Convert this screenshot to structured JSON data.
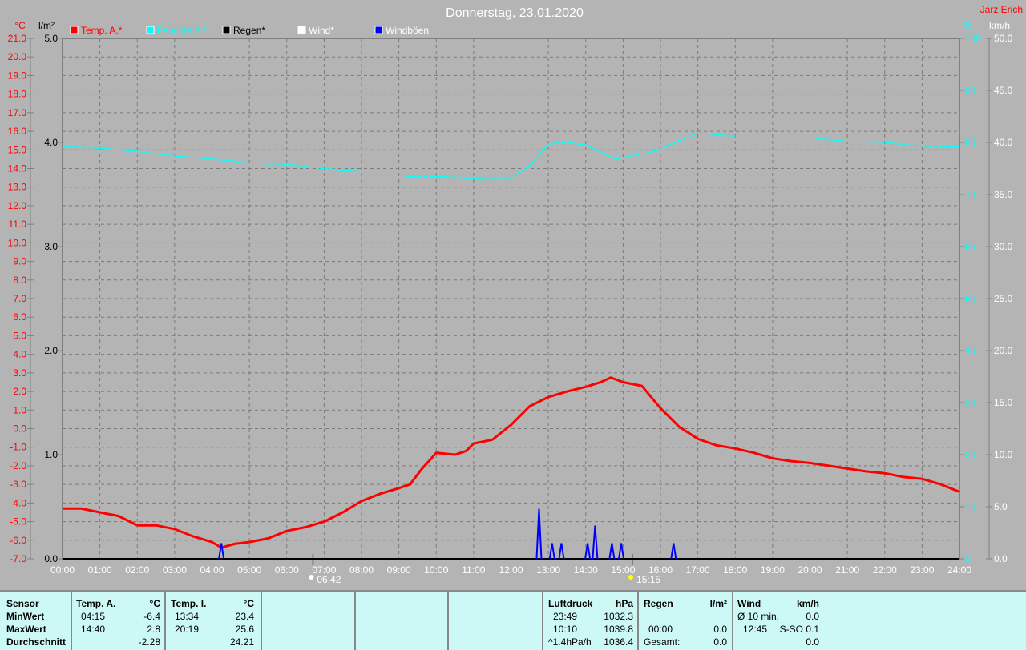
{
  "header": {
    "title": "Donnerstag, 23.01.2020",
    "author": "Jarz Erich"
  },
  "legend": [
    {
      "label": "Temp. A.*",
      "color": "#ff0000",
      "text_color": "#ff0000"
    },
    {
      "label": "Feuchte A.*",
      "color": "#00ffff",
      "text_color": "#00ffff"
    },
    {
      "label": "Regen*",
      "color": "#000000",
      "text_color": "#000000"
    },
    {
      "label": "Wind*",
      "color": "#ffffff",
      "text_color": "#ffffff"
    },
    {
      "label": "Windböen",
      "color": "#0000ff",
      "text_color": "#ffffff"
    }
  ],
  "chart_data": {
    "type": "line",
    "title": "Donnerstag, 23.01.2020",
    "x_ticks": [
      "00:00",
      "01:00",
      "02:00",
      "03:00",
      "04:00",
      "05:00",
      "06:00",
      "07:00",
      "08:00",
      "09:00",
      "10:00",
      "11:00",
      "12:00",
      "13:00",
      "14:00",
      "15:00",
      "16:00",
      "17:00",
      "18:00",
      "19:00",
      "20:00",
      "21:00",
      "22:00",
      "23:00",
      "24:00"
    ],
    "xlim": [
      0,
      24
    ],
    "axes": {
      "temp": {
        "unit": "°C",
        "ylim": [
          -7,
          21
        ],
        "ticks": [
          21,
          20,
          19,
          18,
          17,
          16,
          15,
          14,
          13,
          12,
          11,
          10,
          9,
          8,
          7,
          6,
          5,
          4,
          3,
          2,
          1,
          0,
          -1,
          -2,
          -3,
          -4,
          -5,
          -6,
          -7
        ],
        "color": "#ff0000"
      },
      "rain": {
        "unit": "l/m²",
        "ylim": [
          0,
          5
        ],
        "ticks": [
          5,
          4,
          3,
          2,
          1,
          0
        ],
        "color": "#000000"
      },
      "humidity": {
        "unit": "%",
        "ylim": [
          0,
          100
        ],
        "ticks": [
          100,
          90,
          80,
          70,
          60,
          50,
          40,
          30,
          20,
          10,
          0
        ],
        "color": "#00ffff"
      },
      "wind": {
        "unit": "km/h",
        "ylim": [
          0,
          50
        ],
        "ticks": [
          50,
          45,
          40,
          35,
          30,
          25,
          20,
          15,
          10,
          5,
          0
        ],
        "color": "#ffffff"
      }
    },
    "series": [
      {
        "name": "Temp. A.",
        "axis": "temp",
        "color": "#ff0000",
        "points": [
          [
            0,
            -4.3
          ],
          [
            0.5,
            -4.3
          ],
          [
            1,
            -4.5
          ],
          [
            1.5,
            -4.7
          ],
          [
            2,
            -5.2
          ],
          [
            2.5,
            -5.2
          ],
          [
            3,
            -5.4
          ],
          [
            3.5,
            -5.8
          ],
          [
            4,
            -6.1
          ],
          [
            4.25,
            -6.4
          ],
          [
            4.6,
            -6.2
          ],
          [
            5,
            -6.1
          ],
          [
            5.5,
            -5.9
          ],
          [
            6,
            -5.5
          ],
          [
            6.5,
            -5.3
          ],
          [
            7,
            -5.0
          ],
          [
            7.5,
            -4.5
          ],
          [
            8,
            -3.9
          ],
          [
            8.5,
            -3.5
          ],
          [
            9,
            -3.2
          ],
          [
            9.3,
            -3.0
          ],
          [
            9.6,
            -2.2
          ],
          [
            10,
            -1.3
          ],
          [
            10.5,
            -1.4
          ],
          [
            10.8,
            -1.2
          ],
          [
            11,
            -0.8
          ],
          [
            11.5,
            -0.6
          ],
          [
            12,
            0.2
          ],
          [
            12.5,
            1.2
          ],
          [
            13,
            1.7
          ],
          [
            13.5,
            2.0
          ],
          [
            14,
            2.25
          ],
          [
            14.4,
            2.5
          ],
          [
            14.67,
            2.75
          ],
          [
            15,
            2.5
          ],
          [
            15.5,
            2.3
          ],
          [
            16,
            1.1
          ],
          [
            16.5,
            0.1
          ],
          [
            17,
            -0.55
          ],
          [
            17.5,
            -0.9
          ],
          [
            18,
            -1.07
          ],
          [
            18.5,
            -1.3
          ],
          [
            19,
            -1.6
          ],
          [
            19.5,
            -1.75
          ],
          [
            20,
            -1.85
          ],
          [
            20.5,
            -2.0
          ],
          [
            21,
            -2.15
          ],
          [
            21.5,
            -2.3
          ],
          [
            22,
            -2.4
          ],
          [
            22.5,
            -2.6
          ],
          [
            23,
            -2.7
          ],
          [
            23.5,
            -3.0
          ],
          [
            24,
            -3.4
          ]
        ]
      },
      {
        "name": "Feuchte A.",
        "axis": "humidity",
        "color": "#00ffff",
        "points": [
          [
            0,
            79.1
          ],
          [
            0.8,
            79.0
          ],
          [
            1.5,
            78.6
          ],
          [
            2,
            78.3
          ],
          [
            2.5,
            77.8
          ],
          [
            3,
            77.4
          ],
          [
            4,
            76.8
          ],
          [
            4.5,
            76.5
          ],
          [
            5,
            76.0
          ],
          [
            6,
            75.8
          ],
          [
            7,
            75.0
          ],
          [
            8,
            74.5
          ],
          [
            8.1,
            null
          ],
          [
            9.2,
            73.5
          ],
          [
            10,
            73.5
          ],
          [
            11,
            73.2
          ],
          [
            12,
            73.3
          ],
          [
            12.5,
            75.5
          ],
          [
            13,
            79.7
          ],
          [
            13.5,
            80.0
          ],
          [
            14,
            79.5
          ],
          [
            14.8,
            76.8
          ],
          [
            15.5,
            77.8
          ],
          [
            16,
            78.6
          ],
          [
            16.5,
            80.4
          ],
          [
            17,
            81.8
          ],
          [
            17.5,
            81.5
          ],
          [
            18,
            81.2
          ],
          [
            18.05,
            null
          ],
          [
            20,
            80.9
          ],
          [
            21,
            80.2
          ],
          [
            22,
            80.0
          ],
          [
            23,
            79.3
          ],
          [
            24,
            79.1
          ]
        ]
      },
      {
        "name": "Regen",
        "axis": "rain",
        "color": "#000000",
        "points": [
          [
            0,
            0
          ],
          [
            24,
            0
          ]
        ]
      },
      {
        "name": "Windböen",
        "axis": "wind",
        "color": "#0000ff",
        "spikes": [
          [
            4.25,
            1.5
          ],
          [
            12.75,
            4.8
          ],
          [
            13.1,
            1.5
          ],
          [
            13.35,
            1.5
          ],
          [
            14.05,
            1.5
          ],
          [
            14.25,
            3.2
          ],
          [
            14.7,
            1.5
          ],
          [
            14.95,
            1.5
          ],
          [
            16.35,
            1.5
          ]
        ]
      }
    ],
    "annotations": [
      {
        "label": "06:42",
        "type": "sunrise",
        "x": 6.7
      },
      {
        "label": "15:15",
        "type": "sunset",
        "x": 15.25
      }
    ],
    "grid": true
  },
  "stats": {
    "temp": {
      "sensor": "Sensor",
      "min": "MinWert",
      "max": "MaxWert",
      "avg": "Durchschnitt",
      "a_title": "Temp. A.",
      "a_unit": "°C",
      "a_min_time": "04:15",
      "a_min": "-6.4",
      "a_max_time": "14:40",
      "a_max": "2.8",
      "a_avg": "-2.28",
      "i_title": "Temp. I.",
      "i_unit": "°C",
      "i_min_time": "13:34",
      "i_min": "23.4",
      "i_max_time": "20:19",
      "i_max": "25.6",
      "i_avg": "24.21"
    },
    "pressure": {
      "title": "Luftdruck",
      "unit": "hPa",
      "min_time": "23:49",
      "min": "1032.3",
      "max_time": "10:10",
      "max": "1039.8",
      "trend": "^1.4hPa/h",
      "avg": "1036.4"
    },
    "rain": {
      "title": "Regen",
      "unit": "l/m²",
      "time": "00:00",
      "value": "0.0",
      "total_label": "Gesamt:",
      "total": "0.0"
    },
    "wind": {
      "title": "Wind",
      "unit": "km/h",
      "avg_label": "Ø 10 min.",
      "avg": "0.0",
      "max_time": "12:45",
      "max": "S-SO 0.1",
      "last": "0.0"
    }
  }
}
